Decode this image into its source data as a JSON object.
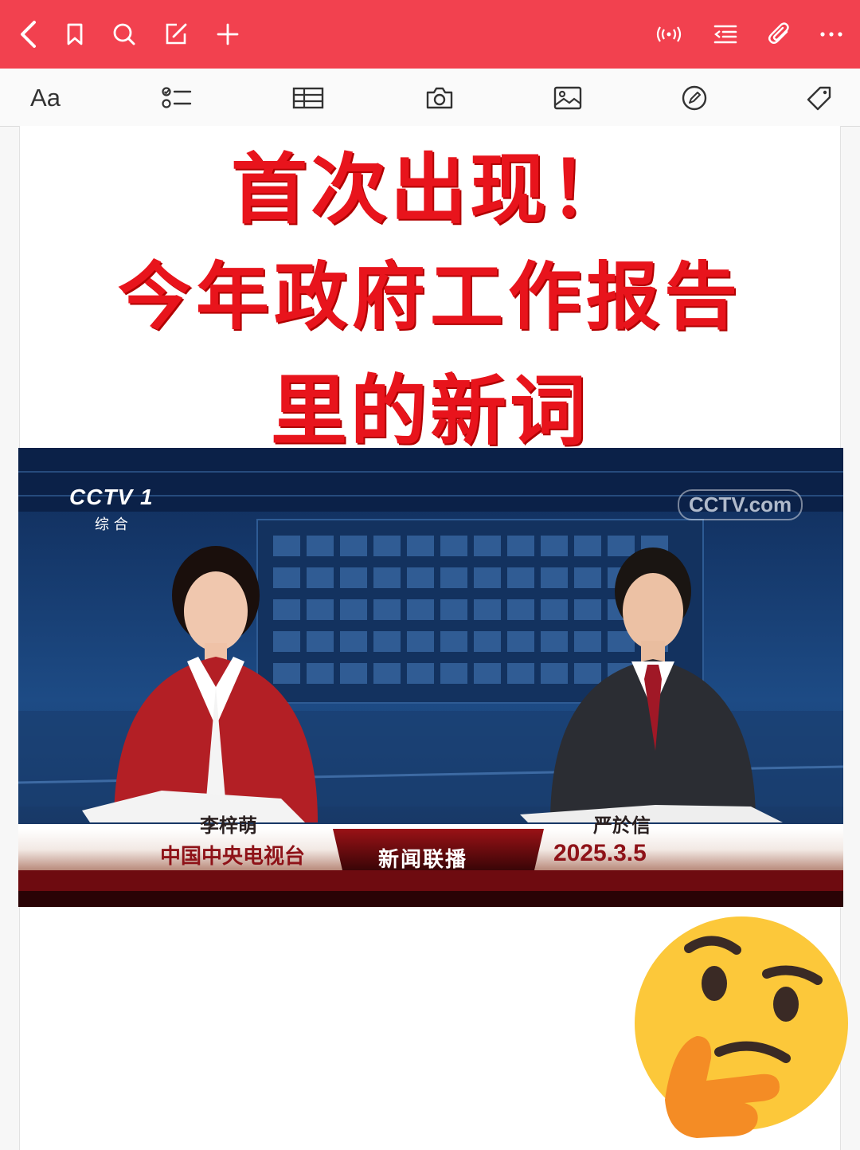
{
  "topbar": {
    "icons": [
      "back-chevron-icon",
      "bookmark-icon",
      "search-icon",
      "edit-icon",
      "add-icon",
      "broadcast-icon",
      "outline-icon",
      "attachment-icon",
      "more-icon"
    ]
  },
  "toolbar": {
    "format_label": "Aa",
    "icons": [
      "checklist-icon",
      "table-icon",
      "camera-icon",
      "image-icon",
      "pencil-icon",
      "tag-icon"
    ]
  },
  "content": {
    "headline_line1": "首次出现！",
    "headline_line2": "今年政府工作报告",
    "headline_line3": "里的新词",
    "news_image": {
      "channel_logo": "CCTV 1",
      "channel_sub": "综 合",
      "watermark": "CCTV.com",
      "anchor_left": "李梓萌",
      "anchor_right": "严於信",
      "lower_left": "中国中央电视台",
      "lower_center": "新闻联播",
      "lower_right": "2025.3.5"
    },
    "emoji": "thinking-face"
  },
  "colors": {
    "topbar": "#f2414f",
    "headline": "#e8141c"
  }
}
